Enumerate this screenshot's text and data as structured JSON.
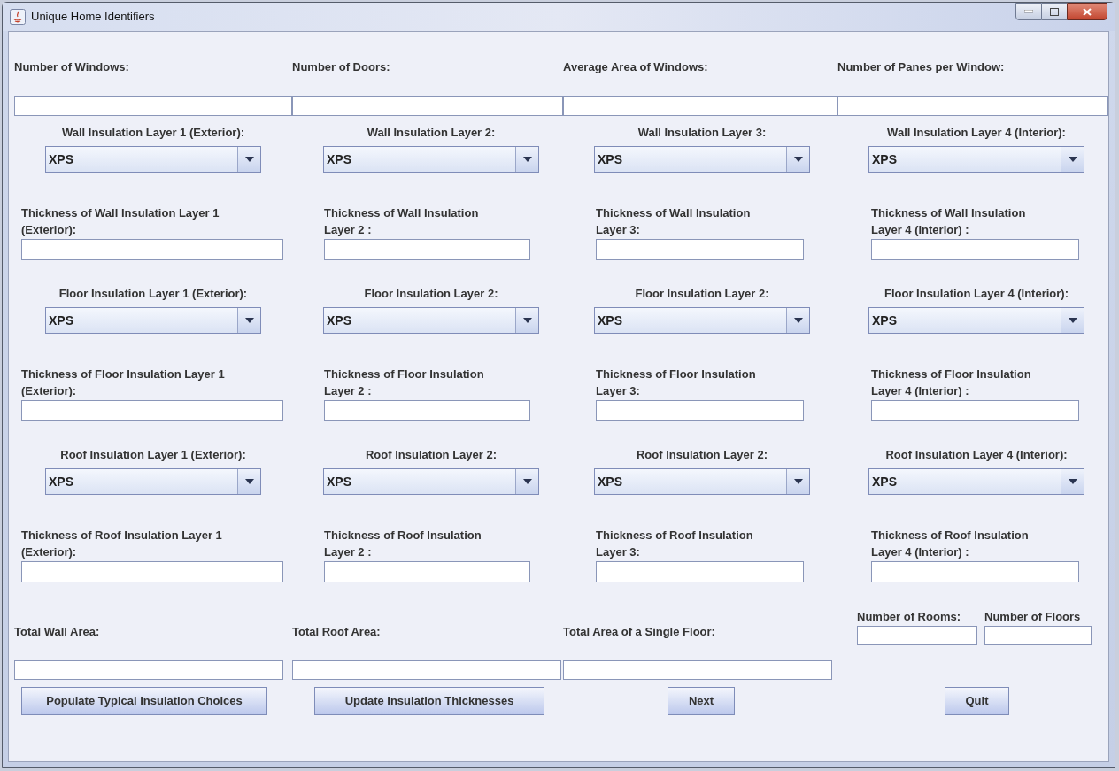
{
  "window": {
    "title": "Unique Home Identifiers"
  },
  "top_fields": [
    {
      "label": "Number of Windows:"
    },
    {
      "label": "Number of Doors:"
    },
    {
      "label": "Average Area of Windows:"
    },
    {
      "label": "Number of Panes per Window:"
    }
  ],
  "sections": [
    {
      "combos": [
        {
          "label": "Wall Insulation Layer 1 (Exterior):",
          "value": "XPS"
        },
        {
          "label": "Wall Insulation Layer 2:",
          "value": "XPS"
        },
        {
          "label": "Wall Insulation Layer 3:",
          "value": "XPS"
        },
        {
          "label": "Wall Insulation Layer 4 (Interior):",
          "value": "XPS"
        }
      ],
      "thickness": [
        {
          "label": "Thickness of Wall Insulation Layer 1\n(Exterior):"
        },
        {
          "label": "Thickness of Wall Insulation\nLayer 2 :"
        },
        {
          "label": "Thickness of Wall Insulation\nLayer 3:"
        },
        {
          "label": "Thickness of Wall Insulation\nLayer 4 (Interior) :"
        }
      ]
    },
    {
      "combos": [
        {
          "label": "Floor Insulation Layer 1 (Exterior):",
          "value": "XPS"
        },
        {
          "label": "Floor Insulation Layer 2:",
          "value": "XPS"
        },
        {
          "label": "Floor Insulation Layer 2:",
          "value": "XPS"
        },
        {
          "label": "Floor Insulation Layer 4 (Interior):",
          "value": "XPS"
        }
      ],
      "thickness": [
        {
          "label": "Thickness of Floor Insulation Layer 1\n(Exterior):"
        },
        {
          "label": "Thickness of Floor Insulation\nLayer 2 :"
        },
        {
          "label": "Thickness of Floor Insulation\nLayer 3:"
        },
        {
          "label": "Thickness of Floor Insulation\nLayer 4 (Interior) :"
        }
      ]
    },
    {
      "combos": [
        {
          "label": "Roof Insulation Layer 1 (Exterior):",
          "value": "XPS"
        },
        {
          "label": "Roof Insulation Layer 2:",
          "value": "XPS"
        },
        {
          "label": "Roof Insulation Layer 2:",
          "value": "XPS"
        },
        {
          "label": "Roof Insulation Layer 4 (Interior):",
          "value": "XPS"
        }
      ],
      "thickness": [
        {
          "label": "Thickness of Roof Insulation Layer 1\n(Exterior):"
        },
        {
          "label": "Thickness of Roof Insulation\nLayer 2 :"
        },
        {
          "label": "Thickness of Roof Insulation\nLayer 3:"
        },
        {
          "label": "Thickness of Roof Insulation\nLayer 4 (Interior) :"
        }
      ]
    }
  ],
  "totals": [
    {
      "label": "Total Wall Area:"
    },
    {
      "label": "Total Roof Area:"
    },
    {
      "label": "Total Area of a Single Floor:"
    }
  ],
  "counts": [
    {
      "label": "Number of Rooms:"
    },
    {
      "label": "Number of Floors"
    }
  ],
  "buttons": [
    "Populate Typical Insulation Choices",
    "Update Insulation Thicknesses",
    "Next",
    "Quit"
  ]
}
